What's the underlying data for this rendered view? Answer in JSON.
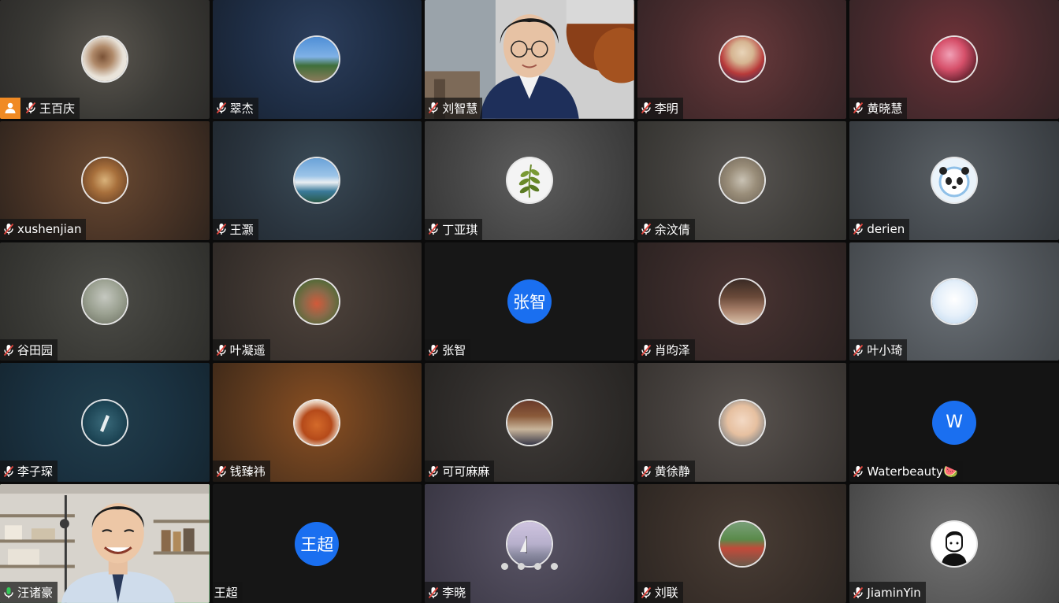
{
  "participants": [
    {
      "name": "王百庆",
      "muted": true,
      "host": true
    },
    {
      "name": "翠杰",
      "muted": true
    },
    {
      "name": "刘智慧",
      "muted": true,
      "video": true
    },
    {
      "name": "李明",
      "muted": true
    },
    {
      "name": "黄晓慧",
      "muted": true
    },
    {
      "name": "xushenjian",
      "muted": true
    },
    {
      "name": "王灏",
      "muted": true
    },
    {
      "name": "丁亚琪",
      "muted": true
    },
    {
      "name": "余汶倩",
      "muted": true
    },
    {
      "name": "derien",
      "muted": true
    },
    {
      "name": "谷田园",
      "muted": true
    },
    {
      "name": "叶凝遥",
      "muted": true
    },
    {
      "name": "张智",
      "muted": true,
      "initials": "张智"
    },
    {
      "name": "肖昀泽",
      "muted": true
    },
    {
      "name": "叶小琦",
      "muted": true
    },
    {
      "name": "李子琛",
      "muted": true
    },
    {
      "name": "钱臻祎",
      "muted": true
    },
    {
      "name": "可可麻麻",
      "muted": true
    },
    {
      "name": "黄徐静",
      "muted": true
    },
    {
      "name": "Waterbeauty🍉",
      "muted": true,
      "initials": "W"
    },
    {
      "name": "汪诸豪",
      "muted": false,
      "speaking": true,
      "video": true
    },
    {
      "name": "王超",
      "muted": null,
      "initials": "王超"
    },
    {
      "name": "李晓",
      "muted": true
    },
    {
      "name": "刘联",
      "muted": true
    },
    {
      "name": "JiaminYin",
      "muted": true
    }
  ],
  "colors": {
    "initials_bg": "#1a6ff0",
    "speaking_border": "#35c759",
    "host_badge": "#f08a24",
    "muted_icon": "#ffffff",
    "mute_slash": "#e0463e"
  }
}
